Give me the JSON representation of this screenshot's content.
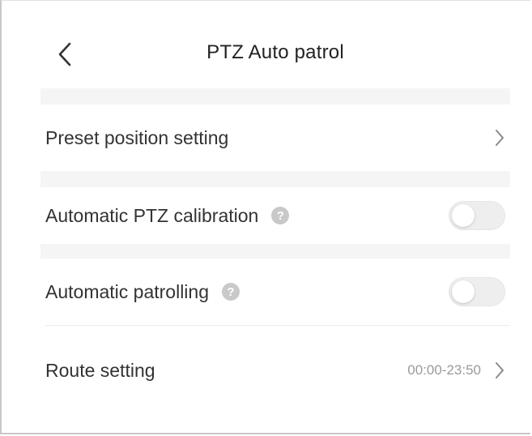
{
  "header": {
    "title": "PTZ Auto patrol",
    "back_icon": "chevron-left-icon"
  },
  "rows": [
    {
      "label": "Preset position setting",
      "control": "chevron"
    },
    {
      "label": "Automatic PTZ calibration",
      "help": "?",
      "control": "toggle",
      "enabled": false
    },
    {
      "label": "Automatic patrolling",
      "help": "?",
      "control": "toggle",
      "enabled": false
    },
    {
      "label": "Route setting",
      "value": "00:00-23:50",
      "control": "chevron"
    }
  ],
  "colors": {
    "text_primary": "#333333",
    "text_secondary": "#9a9a9a",
    "divider": "#f5f5f5",
    "toggle_off": "#eeeeee",
    "help_icon": "#c9c9c9"
  }
}
